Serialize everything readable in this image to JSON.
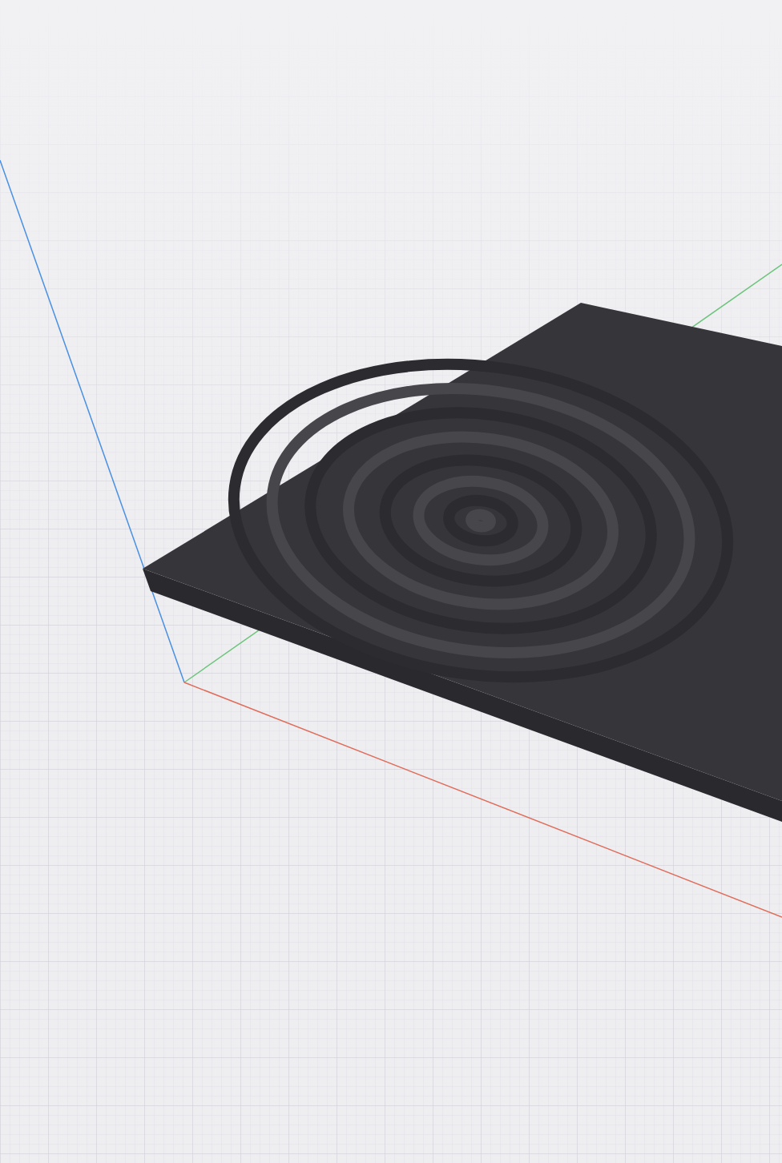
{
  "viewport": {
    "axes": [
      {
        "kind": "x",
        "color": "#e06c5a"
      },
      {
        "kind": "y",
        "color": "#6cc47a"
      },
      {
        "kind": "z",
        "color": "#4a90e2"
      }
    ]
  }
}
